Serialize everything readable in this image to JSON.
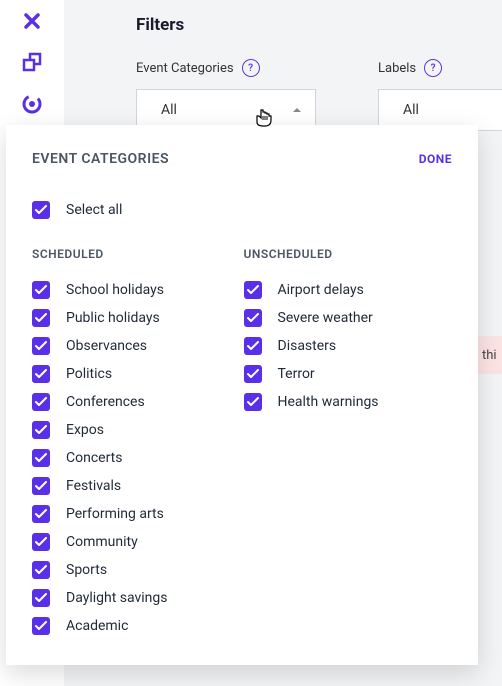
{
  "sidebar": {
    "icons": [
      "close-icon",
      "layers-icon",
      "target-icon"
    ]
  },
  "main": {
    "filters_title": "Filters",
    "event_categories_label": "Event Categories",
    "labels_label": "Labels",
    "event_categories_value": "All",
    "labels_value": "All"
  },
  "peek": {
    "text": "thi"
  },
  "popover": {
    "title": "EVENT CATEGORIES",
    "done": "DONE",
    "select_all": "Select all",
    "scheduled_heading": "SCHEDULED",
    "unscheduled_heading": "UNSCHEDULED",
    "scheduled": [
      "School holidays",
      "Public holidays",
      "Observances",
      "Politics",
      "Conferences",
      "Expos",
      "Concerts",
      "Festivals",
      "Performing arts",
      "Community",
      "Sports",
      "Daylight savings",
      "Academic"
    ],
    "unscheduled": [
      "Airport delays",
      "Severe weather",
      "Disasters",
      "Terror",
      "Health warnings"
    ]
  }
}
